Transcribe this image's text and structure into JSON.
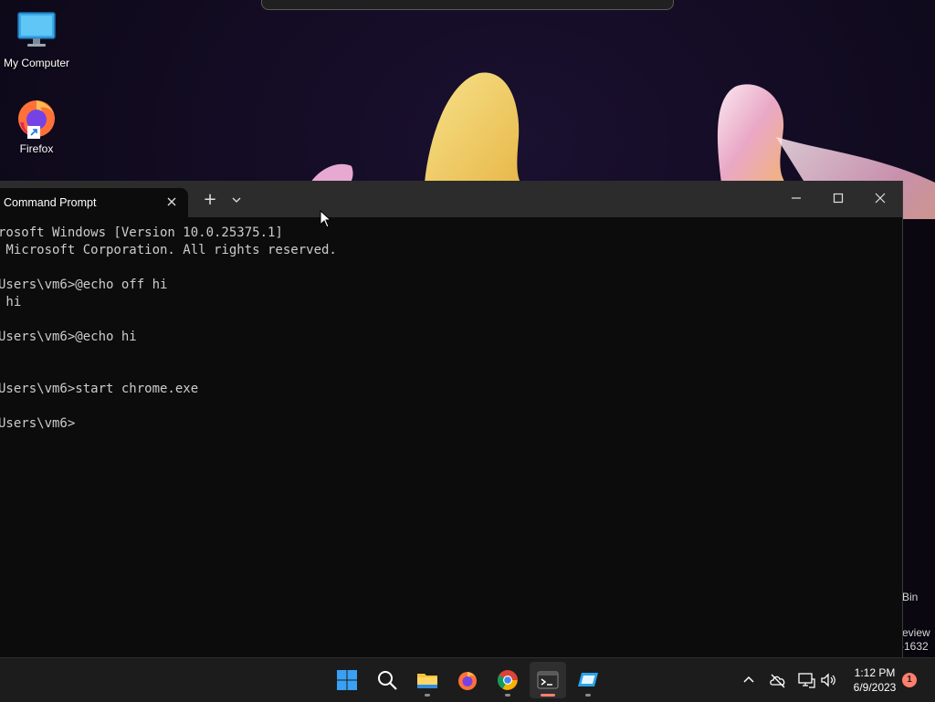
{
  "desktop": {
    "icons": [
      {
        "label": "My Computer",
        "icon": "monitor-icon"
      },
      {
        "label": "Firefox",
        "icon": "firefox-icon"
      }
    ],
    "partial_labels": [
      "Bin",
      "eview",
      "-1632"
    ]
  },
  "terminal": {
    "tab_title": "Command Prompt",
    "new_tab_label": "+",
    "lines": [
      "rosoft Windows [Version 10.0.25375.1]",
      " Microsoft Corporation. All rights reserved.",
      "",
      "Users\\vm6>@echo off hi",
      " hi",
      "",
      "Users\\vm6>@echo hi",
      "",
      "",
      "Users\\vm6>start chrome.exe",
      "",
      "Users\\vm6>"
    ]
  },
  "taskbar": {
    "apps": [
      {
        "name": "start",
        "icon": "windows-logo-icon"
      },
      {
        "name": "search",
        "icon": "search-icon"
      },
      {
        "name": "file-explorer",
        "icon": "folder-icon"
      },
      {
        "name": "firefox",
        "icon": "firefox-icon"
      },
      {
        "name": "chrome",
        "icon": "chrome-icon"
      },
      {
        "name": "terminal",
        "icon": "terminal-icon"
      },
      {
        "name": "remote-desktop",
        "icon": "remote-desktop-icon"
      }
    ],
    "clock": {
      "time": "1:12 PM",
      "date": "6/9/2023"
    },
    "notification_count": "1"
  },
  "colors": {
    "accent": "#ff7f6e",
    "terminal_bg": "#0c0c0c",
    "titlebar_bg": "#2c2c2c",
    "taskbar_bg": "#1c1c1c",
    "text": "#cccccc"
  }
}
